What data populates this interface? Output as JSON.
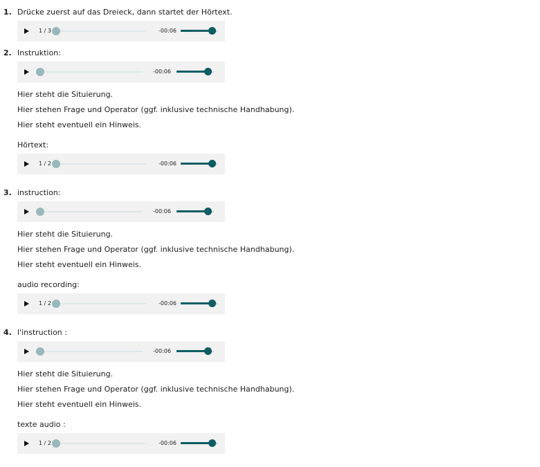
{
  "items": [
    {
      "number": "1.",
      "instruction": "Drücke zuerst auf das Dreieck, dann startet der Hörtext.",
      "player": {
        "counter": "1 / 3",
        "time": "-00:06",
        "progress": 0,
        "volume": 0.8
      }
    },
    {
      "number": "2.",
      "instruction": "Instruktion:",
      "player": {
        "time": "-00:06",
        "progress": 0,
        "volume": 0.8
      },
      "lines": [
        "Hier steht die Situierung.",
        "Hier stehen Frage und Operator (ggf. inklusive technische Handhabung).",
        "Hier steht eventuell ein Hinweis."
      ],
      "audio_label": "Hörtext:",
      "audio_player": {
        "counter": "1 / 2",
        "time": "-00:06",
        "progress": 0,
        "volume": 0.8
      }
    },
    {
      "number": "3.",
      "instruction": "instruction:",
      "player": {
        "time": "-00:06",
        "progress": 0,
        "volume": 0.8
      },
      "lines": [
        "Hier steht die Situierung.",
        "Hier stehen Frage und Operator (ggf. inklusive technische Handhabung).",
        "Hier steht eventuell ein Hinweis."
      ],
      "audio_label": "audio recording:",
      "audio_player": {
        "counter": "1 / 2",
        "time": "-00:06",
        "progress": 0,
        "volume": 0.8
      }
    },
    {
      "number": "4.",
      "instruction": "l'instruction :",
      "player": {
        "time": "-00:06",
        "progress": 0,
        "volume": 0.8
      },
      "lines": [
        "Hier steht die Situierung.",
        "Hier stehen Frage und Operator (ggf. inklusive technische Handhabung).",
        "Hier steht eventuell ein Hinweis."
      ],
      "audio_label": "texte audio :",
      "audio_player": {
        "counter": "1 / 2",
        "time": "-00:06",
        "progress": 0,
        "volume": 0.8
      }
    }
  ]
}
